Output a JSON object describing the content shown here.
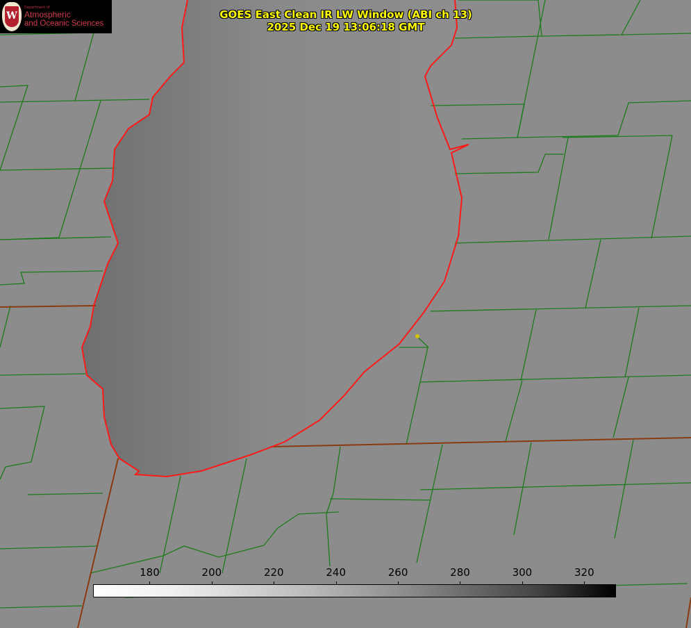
{
  "logo": {
    "line0": "Department of",
    "line1": "Atmospheric",
    "line2": "and Oceanic Sciences",
    "seal_letter": "W"
  },
  "title": {
    "line1": "GOES East Clean IR LW Window (ABI ch 13)",
    "line2": "2025 Dec 19 13:06:18 GMT"
  },
  "colorbar": {
    "ticks": [
      "180",
      "200",
      "220",
      "240",
      "260",
      "280",
      "300",
      "320"
    ],
    "tick_values": [
      180,
      200,
      220,
      240,
      260,
      280,
      300,
      320
    ],
    "range": [
      162,
      330
    ],
    "low_color": "#ffffff",
    "high_color": "#000000"
  },
  "colors": {
    "county_lines": "#1d7a1d",
    "coastline": "#ff1a1a",
    "marker": "#d4c400"
  }
}
